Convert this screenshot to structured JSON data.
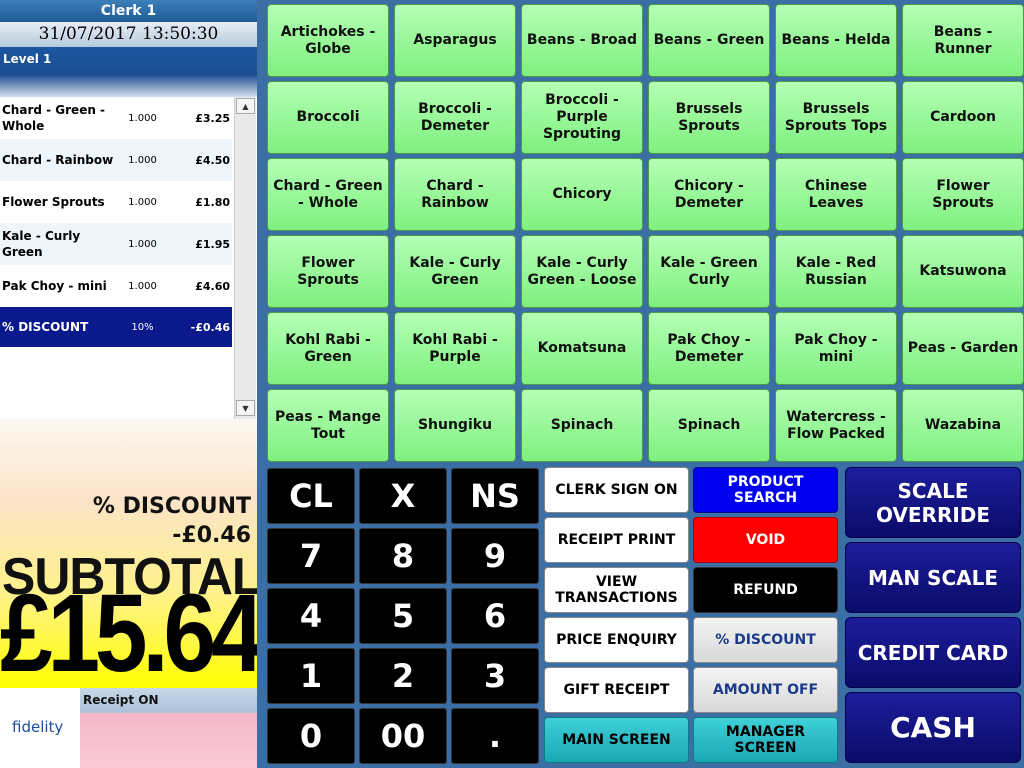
{
  "header": {
    "clerk": "Clerk 1",
    "datetime": "31/07/2017 13:50:30",
    "level": "Level 1"
  },
  "items": [
    {
      "name": "Chard - Green - Whole",
      "qty": "1.000",
      "price": "£3.25"
    },
    {
      "name": "Chard - Rainbow",
      "qty": "1.000",
      "price": "£4.50"
    },
    {
      "name": "Flower Sprouts",
      "qty": "1.000",
      "price": "£1.80"
    },
    {
      "name": "Kale - Curly Green",
      "qty": "1.000",
      "price": "£1.95"
    },
    {
      "name": "Pak Choy - mini",
      "qty": "1.000",
      "price": "£4.60"
    },
    {
      "name": "% DISCOUNT",
      "qty": "10%",
      "price": "-£0.46"
    }
  ],
  "totals": {
    "discount_label": "% DISCOUNT",
    "discount_value": "-£0.46",
    "subtotal_label": "SUBTOTAL",
    "subtotal_value": "£15.64"
  },
  "footer": {
    "logo": "fidelity",
    "receipt_status": "Receipt ON"
  },
  "products": [
    "Artichokes - Globe",
    "Asparagus",
    "Beans - Broad",
    "Beans - Green",
    "Beans - Helda",
    "Beans - Runner",
    "Broccoli",
    "Broccoli - Demeter",
    "Broccoli - Purple Sprouting",
    "Brussels Sprouts",
    "Brussels Sprouts Tops",
    "Cardoon",
    "Chard - Green - Whole",
    "Chard - Rainbow",
    "Chicory",
    "Chicory - Demeter",
    "Chinese Leaves",
    "Flower Sprouts",
    "Flower Sprouts",
    "Kale - Curly Green",
    "Kale - Curly Green - Loose",
    "Kale - Green Curly",
    "Kale - Red Russian",
    "Katsuwona",
    "Kohl Rabi - Green",
    "Kohl Rabi - Purple",
    "Komatsuna",
    "Pak Choy - Demeter",
    "Pak Choy - mini",
    "Peas - Garden",
    "Peas - Mange Tout",
    "Shungiku",
    "Spinach",
    "Spinach",
    "Watercress - Flow Packed",
    "Wazabina"
  ],
  "keypad": [
    "CL",
    "X",
    "NS",
    "7",
    "8",
    "9",
    "4",
    "5",
    "6",
    "1",
    "2",
    "3",
    "0",
    "00",
    "."
  ],
  "functions": {
    "clerk_sign_on": "CLERK SIGN ON",
    "product_search": "PRODUCT SEARCH",
    "receipt_print": "RECEIPT PRINT",
    "void": "VOID",
    "view_transactions": "VIEW TRANSACTIONS",
    "refund": "REFUND",
    "price_enquiry": "PRICE ENQUIRY",
    "percent_discount": "% DISCOUNT",
    "gift_receipt": "GIFT RECEIPT",
    "amount_off": "AMOUNT OFF",
    "main_screen": "MAIN SCREEN",
    "manager_screen": "MANAGER SCREEN"
  },
  "big_buttons": {
    "scale_override": "SCALE OVERRIDE",
    "man_scale": "MAN SCALE",
    "credit_card": "CREDIT CARD",
    "cash": "CASH"
  },
  "colors": {
    "product_green": "#8ff58f",
    "void_red": "#ff0000",
    "search_blue": "#0000f0",
    "tender_navy": "#12128a",
    "subtotal_yellow": "#ffff00"
  }
}
